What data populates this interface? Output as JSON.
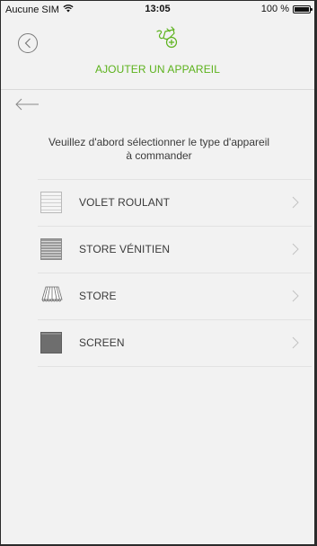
{
  "status_bar": {
    "carrier": "Aucune SIM",
    "time": "13:05",
    "battery": "100 %",
    "battery_level": 1.0
  },
  "header": {
    "title": "AJOUTER UN APPAREIL",
    "back_icon": "chevron-left-circle-icon",
    "device_icon": "plug-add-icon",
    "accent_color": "#5cb21c"
  },
  "content": {
    "instruction": "Veuillez d'abord sélectionner le type d'appareil à commander",
    "items": [
      {
        "label": "VOLET ROULANT",
        "icon": "roller-shutter-icon"
      },
      {
        "label": "STORE VÉNITIEN",
        "icon": "venetian-blind-icon"
      },
      {
        "label": "STORE",
        "icon": "awning-icon"
      },
      {
        "label": "SCREEN",
        "icon": "screen-blind-icon"
      }
    ]
  }
}
